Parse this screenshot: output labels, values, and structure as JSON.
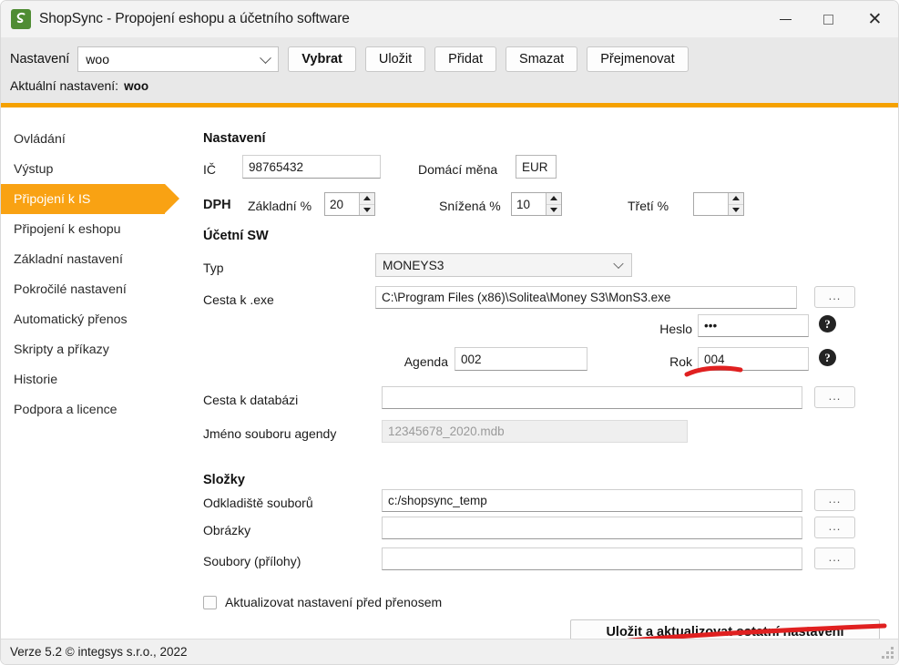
{
  "window": {
    "title": "ShopSync - Propojení eshopu a účetního software",
    "app_icon": "shopsync-logo-icon",
    "brand_color": "#4f8c33",
    "accent_color": "#f5a100",
    "controls": {
      "minimize": "minimize-icon",
      "maximize": "maximize-icon",
      "close": "close-icon"
    }
  },
  "header": {
    "settings_label": "Nastavení",
    "profile_value": "woo",
    "buttons": [
      {
        "label": "Vybrat",
        "primary": true
      },
      {
        "label": "Uložit",
        "primary": false
      },
      {
        "label": "Přidat",
        "primary": false
      },
      {
        "label": "Smazat",
        "primary": false
      },
      {
        "label": "Přejmenovat",
        "primary": false
      }
    ],
    "current_label": "Aktuální nastavení:",
    "current_value": "woo"
  },
  "sidebar": {
    "items": [
      {
        "label": "Ovládání",
        "active": false
      },
      {
        "label": "Výstup",
        "active": false
      },
      {
        "label": "Připojení k IS",
        "active": true
      },
      {
        "label": "Připojení k eshopu",
        "active": false
      },
      {
        "label": "Základní nastavení",
        "active": false
      },
      {
        "label": "Pokročilé nastavení",
        "active": false
      },
      {
        "label": "Automatický přenos",
        "active": false
      },
      {
        "label": "Skripty a příkazy",
        "active": false
      },
      {
        "label": "Historie",
        "active": false
      },
      {
        "label": "Podpora a licence",
        "active": false
      }
    ]
  },
  "main": {
    "section_nastaveni": {
      "title": "Nastavení",
      "ico_label": "IČ",
      "ico_value": "98765432",
      "currency_label": "Domácí měna",
      "currency_value": "EUR",
      "vat_label": "DPH",
      "vat_base_label": "Základní %",
      "vat_base_value": "20",
      "vat_reduced_label": "Snížená %",
      "vat_reduced_value": "10",
      "vat_third_label": "Třetí %",
      "vat_third_value": ""
    },
    "section_ucetni_sw": {
      "title": "Účetní SW",
      "type_label": "Typ",
      "type_value": "MONEYS3",
      "exe_label": "Cesta k .exe",
      "exe_value": "C:\\Program Files (x86)\\Solitea\\Money S3\\MonS3.exe",
      "exe_browse": "...",
      "warning_icon": "warning-triangle-icon",
      "password_label": "Heslo",
      "password_value": "•••",
      "password_help": "?",
      "agenda_label": "Agenda",
      "agenda_value": "002",
      "year_label": "Rok",
      "year_value": "004",
      "year_help": "?",
      "db_label": "Cesta k databázi",
      "db_value": "",
      "db_browse": "...",
      "agenda_file_label": "Jméno souboru agendy",
      "agenda_file_value": "12345678_2020.mdb"
    },
    "section_slozky": {
      "title": "Složky",
      "rows": [
        {
          "label": "Odkladiště souborů",
          "value": "c:/shopsync_temp",
          "browse": "..."
        },
        {
          "label": "Obrázky",
          "value": "",
          "browse": "..."
        },
        {
          "label": "Soubory (přílohy)",
          "value": "",
          "browse": "..."
        }
      ]
    },
    "update_checkbox_label": "Aktualizovat nastavení před přenosem",
    "update_checkbox_checked": false,
    "save_button_label": "Uložit a aktualizovat ostatní nastavení"
  },
  "statusbar": {
    "version_text": "Verze 5.2  © integsys s.r.o., 2022"
  },
  "annotations": {
    "color": "#e02020",
    "marks": [
      {
        "name": "underline-year-field"
      },
      {
        "name": "underline-save-button"
      }
    ]
  }
}
